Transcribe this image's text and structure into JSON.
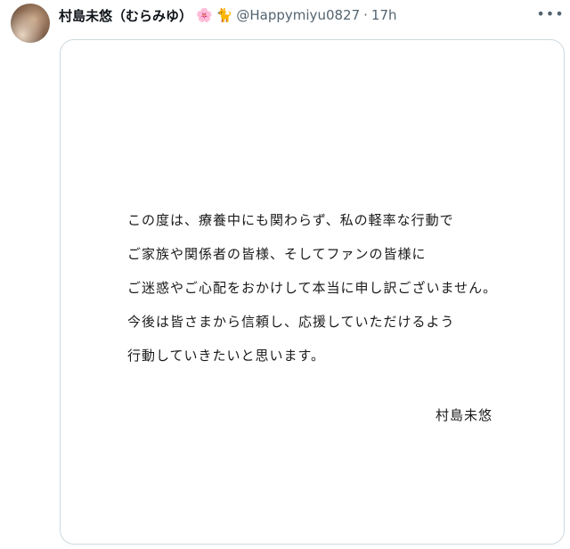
{
  "tweet": {
    "display_name": "村島未悠（むらみゆ）",
    "emojis": {
      "flower": "🌸",
      "cat": "🐈"
    },
    "handle": "@Happymiyu0827",
    "separator": "·",
    "time": "17h",
    "more_icon": "•••",
    "icons": [
      "avatar",
      "flower-icon",
      "cat-icon",
      "more-icon"
    ]
  },
  "image": {
    "statement_lines": [
      "この度は、療養中にも関わらず、私の軽率な行動で",
      "ご家族や関係者の皆様、そしてファンの皆様に",
      "ご迷惑やご心配をおかけして本当に申し訳ございません。",
      "今後は皆さまから信頼し、応援していただけるよう",
      "行動していきたいと思います。"
    ],
    "signature": "村島未悠"
  },
  "colors": {
    "name": "#0f1419",
    "secondary": "#536471",
    "card_border": "#cfd9de"
  }
}
